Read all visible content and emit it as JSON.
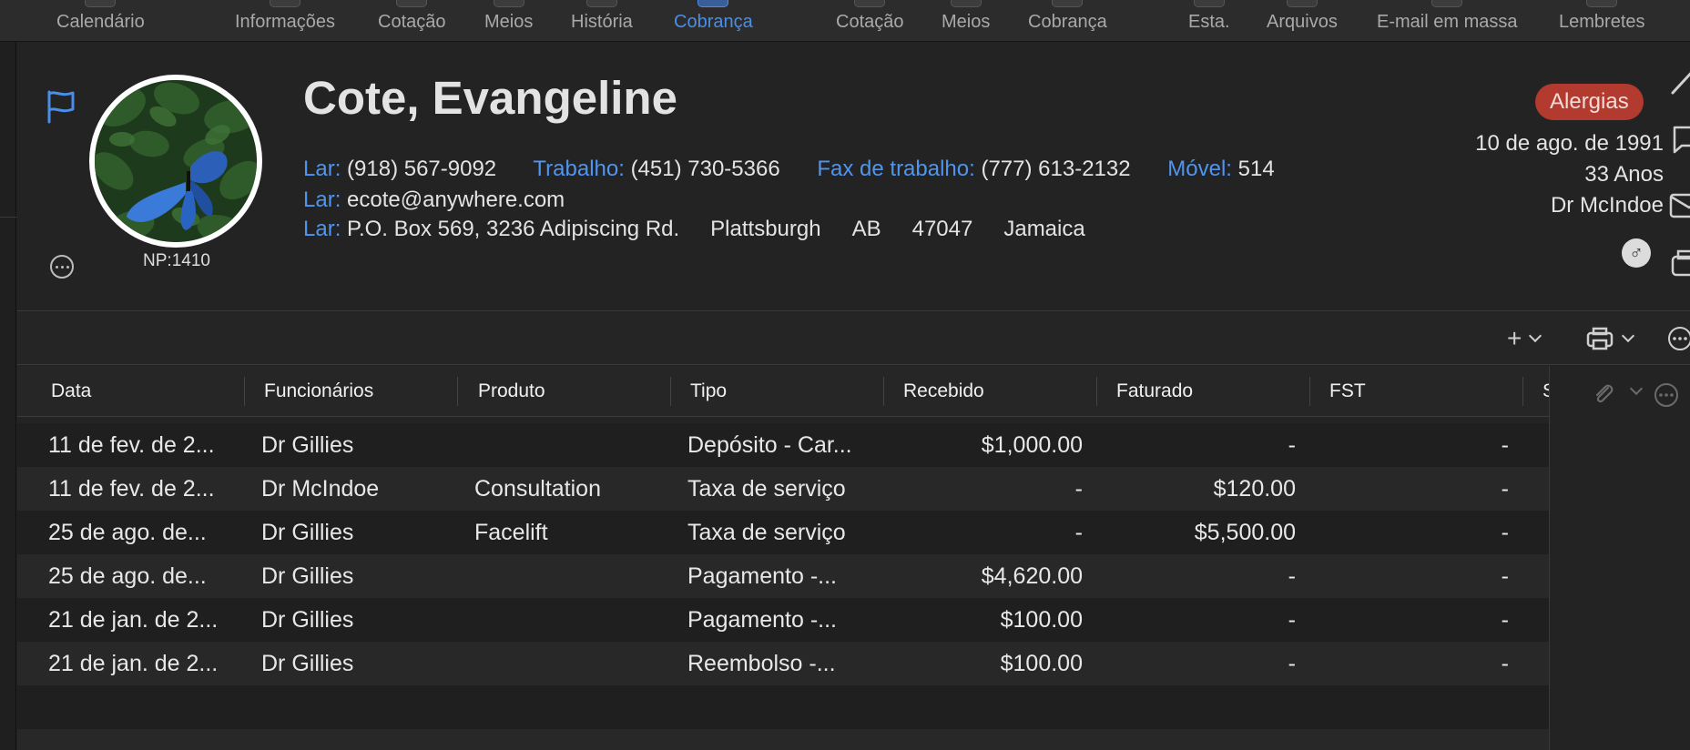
{
  "toolbar": {
    "items": [
      {
        "label": "Calendário"
      },
      {
        "label": "Informações"
      },
      {
        "label": "Cotação"
      },
      {
        "label": "Meios"
      },
      {
        "label": "História"
      },
      {
        "label": "Cobrança"
      },
      {
        "label": "Cotação"
      },
      {
        "label": "Meios"
      },
      {
        "label": "Cobrança"
      },
      {
        "label": "Esta."
      },
      {
        "label": "Arquivos"
      },
      {
        "label": "E-mail em massa"
      },
      {
        "label": "Lembretes"
      }
    ],
    "active_index": 5
  },
  "patient": {
    "name": "Cote, Evangeline",
    "np": "NP:1410",
    "phones": [
      {
        "label": "Lar:",
        "value": "(918) 567-9092"
      },
      {
        "label": "Trabalho:",
        "value": "(451) 730-5366"
      },
      {
        "label": "Fax de trabalho:",
        "value": "(777) 613-2132"
      },
      {
        "label": "Móvel:",
        "value": "514"
      }
    ],
    "email": {
      "label": "Lar:",
      "value": "ecote@anywhere.com"
    },
    "address": {
      "label": "Lar:",
      "street": "P.O. Box 569, 3236 Adipiscing Rd.",
      "city": "Plattsburgh",
      "province": "AB",
      "postal": "47047",
      "country": "Jamaica"
    },
    "allergy_badge": "Alergias",
    "dob": "10 de ago. de 1991",
    "age": "33 Anos",
    "doctor": "Dr McIndoe",
    "gender_symbol": "♂"
  },
  "table": {
    "columns": [
      "Data",
      "Funcionários",
      "Produto",
      "Tipo",
      "Recebido",
      "Faturado",
      "FST",
      "S"
    ],
    "rows": [
      {
        "data": "11 de fev. de 2...",
        "funcionario": "Dr Gillies",
        "produto": "",
        "tipo": "Depósito - Car...",
        "recebido": "$1,000.00",
        "faturado": "-",
        "fst": "-"
      },
      {
        "data": "11 de fev. de 2...",
        "funcionario": "Dr McIndoe",
        "produto": "Consultation",
        "tipo": "Taxa de serviço",
        "recebido": "-",
        "faturado": "$120.00",
        "fst": "-"
      },
      {
        "data": "25 de ago. de...",
        "funcionario": "Dr Gillies",
        "produto": "Facelift",
        "tipo": "Taxa de serviço",
        "recebido": "-",
        "faturado": "$5,500.00",
        "fst": "-"
      },
      {
        "data": "25 de ago. de...",
        "funcionario": "Dr Gillies",
        "produto": "",
        "tipo": "Pagamento -...",
        "recebido": "$4,620.00",
        "faturado": "-",
        "fst": "-"
      },
      {
        "data": "21 de jan. de 2...",
        "funcionario": "Dr Gillies",
        "produto": "",
        "tipo": "Pagamento -...",
        "recebido": "$100.00",
        "faturado": "-",
        "fst": "-"
      },
      {
        "data": "21 de jan. de 2...",
        "funcionario": "Dr Gillies",
        "produto": "",
        "tipo": "Reembolso -...",
        "recebido": "$100.00",
        "faturado": "-",
        "fst": "-"
      }
    ]
  },
  "colors": {
    "accent": "#4a8eea",
    "allergy": "#b23a2e",
    "label_blue": "#4f95f0"
  }
}
